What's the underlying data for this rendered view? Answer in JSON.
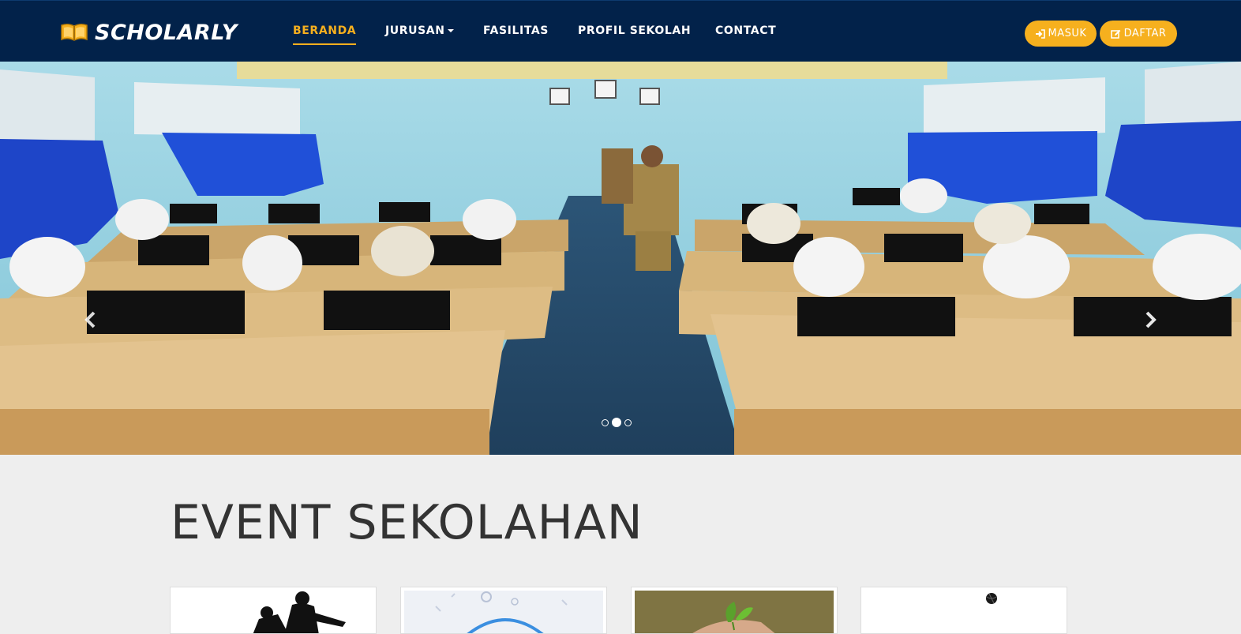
{
  "brand": {
    "name": "SCHOLARLY",
    "logo_icon": "open-book-icon"
  },
  "nav": {
    "items": [
      {
        "label": "BERANDA",
        "active": true
      },
      {
        "label": "JURUSAN",
        "dropdown": true
      },
      {
        "label": "FASILITAS"
      },
      {
        "label": "PROFIL SEKOLAH"
      },
      {
        "label": "CONTACT"
      }
    ],
    "login_label": "MASUK",
    "login_icon": "sign-in-icon",
    "register_label": "DAFTAR",
    "register_icon": "edit-icon"
  },
  "carousel": {
    "slide_alt": "Students in computer lab",
    "indicator_count": 3,
    "active_index": 1,
    "prev_icon": "chevron-left-icon",
    "next_icon": "chevron-right-icon"
  },
  "events": {
    "title": "EVENT SEKOLAHAN",
    "cards": [
      {
        "thumb": "silhouette"
      },
      {
        "thumb": "illustration"
      },
      {
        "thumb": "plant-hand"
      },
      {
        "thumb": "ball"
      }
    ]
  },
  "colors": {
    "navbar_bg": "#02224a",
    "accent": "#f6b01e",
    "page_bg": "#eeeeee",
    "heading": "#333333"
  }
}
